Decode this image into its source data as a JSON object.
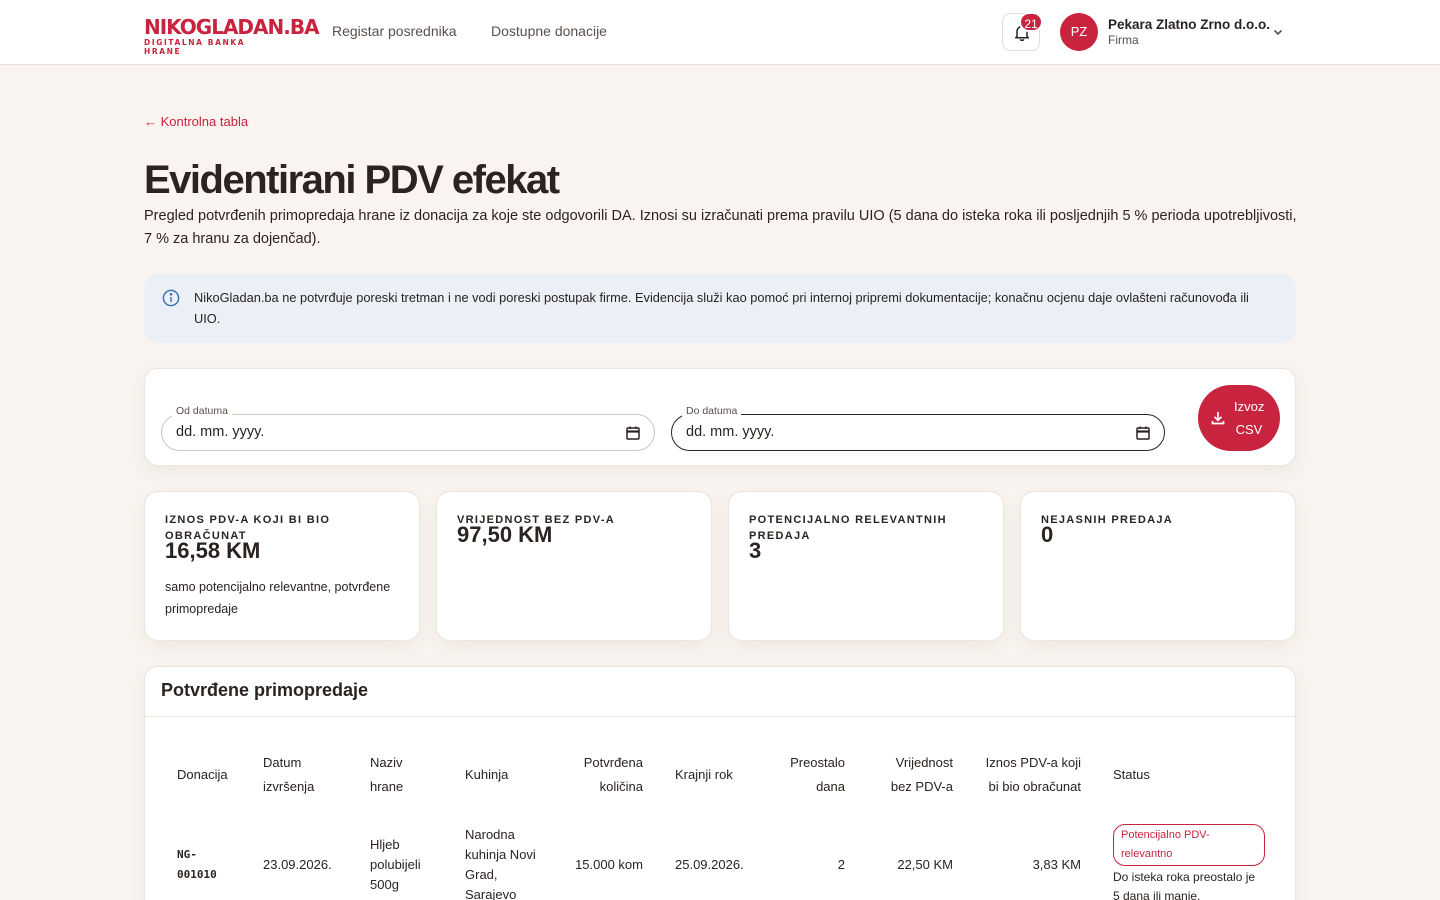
{
  "header": {
    "logo_main": "NIKOGLADAN.BA",
    "logo_sub": "DIGITALNA BANKA HRANE",
    "nav": [
      "Registar posrednika",
      "Dostupne donacije"
    ],
    "notifications_count": "21",
    "user_initials": "PZ",
    "company_name": "Pekara Zlatno Zrno d.o.o.",
    "company_role": "Firma"
  },
  "back_link": "← Kontrolna tabla",
  "page_title": "Evidentirani PDV efekat",
  "page_description": "Pregled potvrđenih primopredaja hrane iz donacija za koje ste odgovorili DA. Iznosi su izračunati prema pravilu UIO (5 dana do isteka roka ili posljednjih 5 % perioda upotrebljivosti, 7 % za hranu za dojenčad).",
  "info_text": "NikoGladan.ba ne potvrđuje poreski tretman i ne vodi poreski postupak firme. Evidencija služi kao pomoć pri internoj pripremi dokumentacije; konačnu ocjenu daje ovlašteni računovođa ili UIO.",
  "filters": {
    "from_label": "Od datuma",
    "from_value": "dd. mm. yyyy.",
    "to_label": "Do datuma",
    "to_value": "dd. mm. yyyy.",
    "export_label": "Izvoz CSV"
  },
  "stats": [
    {
      "label": "Iznos PDV-a koji bi bio obračunat",
      "value": "16,58 KM",
      "note": "samo potencijalno relevantne, potvrđene primopredaje"
    },
    {
      "label": "Vrijednost bez PDV-a",
      "value": "97,50 KM",
      "note": ""
    },
    {
      "label": "Potencijalno relevantnih predaja",
      "value": "3",
      "note": ""
    },
    {
      "label": "Nejasnih predaja",
      "value": "0",
      "note": ""
    }
  ],
  "table": {
    "title": "Potvrđene primopredaje",
    "columns": [
      "Donacija",
      "Datum izvršenja",
      "Naziv hrane",
      "Kuhinja",
      "Potvrđena količina",
      "Krajnji rok",
      "Preostalo dana",
      "Vrijednost bez PDV-a",
      "Iznos PDV-a koji bi bio obračunat",
      "Status"
    ],
    "rows": [
      {
        "donation": "NG-001010",
        "date": "23.09.2026.",
        "food": "Hljeb polubijeli 500g",
        "kitchen": "Narodna kuhinja Novi Grad, Sarajevo",
        "quantity": "15.000 kom",
        "deadline": "25.09.2026.",
        "days_left": "2",
        "value_net": "22,50 KM",
        "vat": "3,83 KM",
        "status_badge": "Potencijalno PDV-relevantno",
        "status_note": "Do isteka roka preostalo je 5 dana ili manje."
      }
    ]
  },
  "colors": {
    "accent": "#c8233f",
    "background": "#f9f4ef",
    "info_bg": "#eaf0f6"
  }
}
